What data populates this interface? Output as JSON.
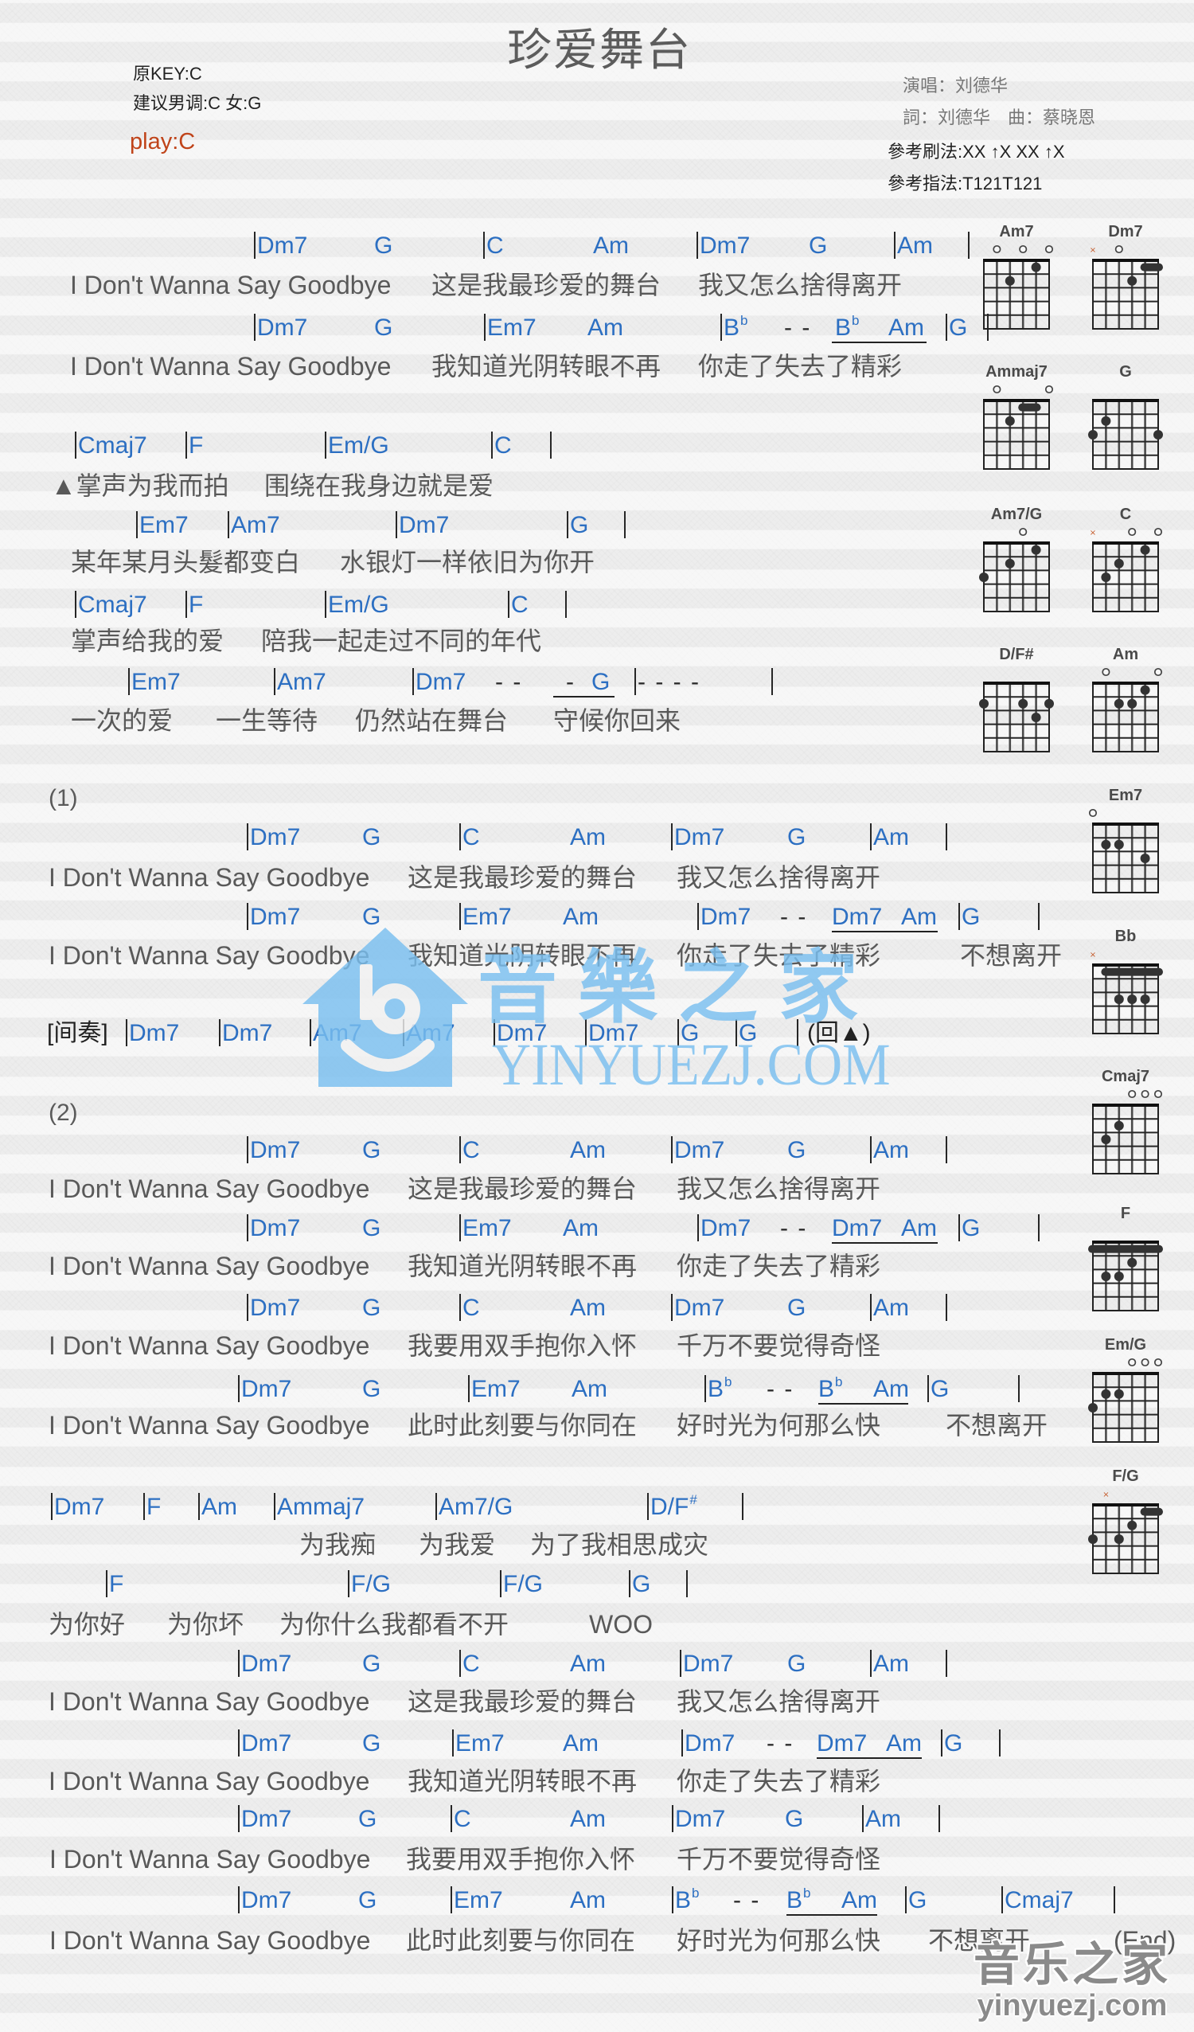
{
  "title": "珍爱舞台",
  "header": {
    "original_key": "原KEY:C",
    "suggested_key": "建议男调:C 女:G",
    "play_key": "play:C",
    "singer": "演唱：刘德华",
    "credits": "詞：刘德华　曲：蔡晓恩",
    "strum_pattern": "參考刷法:XX ↑X XX ↑X",
    "finger_pattern": "參考指法:T121T121"
  },
  "colors": {
    "chord": "#2c6fc2",
    "lyrics": "#595959",
    "play_key": "#c0441a",
    "watermark": "#79bff0"
  },
  "rows": [
    {
      "type": "chords",
      "items": [
        {
          "bar": true,
          "chord": "Dm7"
        },
        {
          "chord": "G"
        },
        {
          "bar": true,
          "chord": "C"
        },
        {
          "chord": "Am"
        },
        {
          "bar": true,
          "chord": "Dm7"
        },
        {
          "chord": "G"
        },
        {
          "bar": true,
          "chord": "Am"
        },
        {
          "bar": true
        }
      ]
    },
    {
      "type": "lyrics",
      "items": [
        "I Don't Wanna Say Goodbye",
        "这是我最珍爱的舞台",
        "我又怎么捨得离开"
      ]
    },
    {
      "type": "chords",
      "items": [
        {
          "bar": true,
          "chord": "Dm7"
        },
        {
          "chord": "G"
        },
        {
          "bar": true,
          "chord": "Em7"
        },
        {
          "chord": "Am"
        },
        {
          "bar": true,
          "chord": "B",
          "sup": "b"
        },
        {
          "text": "- -"
        },
        {
          "chord": "B",
          "sup": "b",
          "tied": true
        },
        {
          "chord": "Am",
          "tied": true
        },
        {
          "bar": true,
          "chord": "G"
        },
        {
          "bar": true
        }
      ]
    },
    {
      "type": "lyrics",
      "items": [
        "I Don't Wanna Say Goodbye",
        "我知道光阴转眼不再",
        "你走了失去了精彩"
      ]
    },
    {
      "type": "chords",
      "items": [
        {
          "bar": true,
          "chord": "Cmaj7"
        },
        {
          "bar": true,
          "chord": "F"
        },
        {
          "bar": true,
          "chord": "Em/G"
        },
        {
          "bar": true,
          "chord": "C"
        },
        {
          "bar": true
        }
      ]
    },
    {
      "type": "lyrics",
      "items": [
        "▲掌声为我而拍",
        "围绕在我身边就是爱"
      ]
    },
    {
      "type": "chords",
      "items": [
        {
          "bar": true,
          "chord": "Em7"
        },
        {
          "bar": true,
          "chord": "Am7"
        },
        {
          "bar": true,
          "chord": "Dm7"
        },
        {
          "bar": true,
          "chord": "G"
        },
        {
          "bar": true
        }
      ]
    },
    {
      "type": "lyrics",
      "items": [
        "某年某月头髮都变白",
        "水银灯一样依旧为你开"
      ]
    },
    {
      "type": "chords",
      "items": [
        {
          "bar": true,
          "chord": "Cmaj7"
        },
        {
          "bar": true,
          "chord": "F"
        },
        {
          "bar": true,
          "chord": "Em/G"
        },
        {
          "bar": true,
          "chord": "C"
        },
        {
          "bar": true
        }
      ]
    },
    {
      "type": "lyrics",
      "items": [
        "掌声给我的爱",
        "陪我一起走过不同的年代"
      ]
    },
    {
      "type": "chords",
      "items": [
        {
          "bar": true,
          "chord": "Em7"
        },
        {
          "bar": true,
          "chord": "Am7"
        },
        {
          "bar": true,
          "chord": "Dm7"
        },
        {
          "text": "- -"
        },
        {
          "text": "-",
          "tied": true
        },
        {
          "chord": "G",
          "tied": true
        },
        {
          "bar": true,
          "text": "- - - -"
        },
        {
          "bar": true
        }
      ]
    },
    {
      "type": "lyrics",
      "items": [
        "一次的爱",
        "一生等待",
        "仍然站在舞台",
        "守候你回来"
      ]
    },
    {
      "type": "label",
      "items": [
        "(1)"
      ]
    },
    {
      "type": "chords",
      "items": [
        {
          "bar": true,
          "chord": "Dm7"
        },
        {
          "chord": "G"
        },
        {
          "bar": true,
          "chord": "C"
        },
        {
          "chord": "Am"
        },
        {
          "bar": true,
          "chord": "Dm7"
        },
        {
          "chord": "G"
        },
        {
          "bar": true,
          "chord": "Am"
        },
        {
          "bar": true
        }
      ]
    },
    {
      "type": "lyrics",
      "items": [
        "I Don't Wanna Say Goodbye",
        "这是我最珍爱的舞台",
        "我又怎么捨得离开"
      ]
    },
    {
      "type": "chords",
      "items": [
        {
          "bar": true,
          "chord": "Dm7"
        },
        {
          "chord": "G"
        },
        {
          "bar": true,
          "chord": "Em7"
        },
        {
          "chord": "Am"
        },
        {
          "bar": true,
          "chord": "Dm7"
        },
        {
          "text": "- -"
        },
        {
          "chord": "Dm7",
          "tied": true
        },
        {
          "chord": "Am",
          "tied": true
        },
        {
          "bar": true,
          "chord": "G"
        },
        {
          "bar": true
        }
      ]
    },
    {
      "type": "lyrics",
      "items": [
        "I Don't Wanna Say Goodbye",
        "我知道光阴转眼不再",
        "你走了失去了精彩",
        "不想离开"
      ]
    },
    {
      "type": "chords",
      "items": [
        {
          "label": "[间奏]"
        },
        {
          "bar": true,
          "chord": "Dm7"
        },
        {
          "bar": true,
          "chord": "Dm7"
        },
        {
          "bar": true,
          "chord": "Am7"
        },
        {
          "bar": true,
          "chord": "Am7"
        },
        {
          "bar": true,
          "chord": "Dm7"
        },
        {
          "bar": true,
          "chord": "Dm7"
        },
        {
          "bar": true,
          "chord": "G"
        },
        {
          "bar": true,
          "chord": "G"
        },
        {
          "bar": true
        },
        {
          "label": "(回▲)"
        }
      ]
    },
    {
      "type": "label",
      "items": [
        "(2)"
      ]
    },
    {
      "type": "chords",
      "items": [
        {
          "bar": true,
          "chord": "Dm7"
        },
        {
          "chord": "G"
        },
        {
          "bar": true,
          "chord": "C"
        },
        {
          "chord": "Am"
        },
        {
          "bar": true,
          "chord": "Dm7"
        },
        {
          "chord": "G"
        },
        {
          "bar": true,
          "chord": "Am"
        },
        {
          "bar": true
        }
      ]
    },
    {
      "type": "lyrics",
      "items": [
        "I Don't Wanna Say Goodbye",
        "这是我最珍爱的舞台",
        "我又怎么捨得离开"
      ]
    },
    {
      "type": "chords",
      "items": [
        {
          "bar": true,
          "chord": "Dm7"
        },
        {
          "chord": "G"
        },
        {
          "bar": true,
          "chord": "Em7"
        },
        {
          "chord": "Am"
        },
        {
          "bar": true,
          "chord": "Dm7"
        },
        {
          "text": "- -"
        },
        {
          "chord": "Dm7",
          "tied": true
        },
        {
          "chord": "Am",
          "tied": true
        },
        {
          "bar": true,
          "chord": "G"
        },
        {
          "bar": true
        }
      ]
    },
    {
      "type": "lyrics",
      "items": [
        "I Don't Wanna Say Goodbye",
        "我知道光阴转眼不再",
        "你走了失去了精彩"
      ]
    },
    {
      "type": "chords",
      "items": [
        {
          "bar": true,
          "chord": "Dm7"
        },
        {
          "chord": "G"
        },
        {
          "bar": true,
          "chord": "C"
        },
        {
          "chord": "Am"
        },
        {
          "bar": true,
          "chord": "Dm7"
        },
        {
          "chord": "G"
        },
        {
          "bar": true,
          "chord": "Am"
        },
        {
          "bar": true
        }
      ]
    },
    {
      "type": "lyrics",
      "items": [
        "I Don't Wanna Say Goodbye",
        "我要用双手抱你入怀",
        "千万不要觉得奇怪"
      ]
    },
    {
      "type": "chords",
      "items": [
        {
          "bar": true,
          "chord": "Dm7"
        },
        {
          "chord": "G"
        },
        {
          "bar": true,
          "chord": "Em7"
        },
        {
          "chord": "Am"
        },
        {
          "bar": true,
          "chord": "B",
          "sup": "b"
        },
        {
          "text": "- -"
        },
        {
          "chord": "B",
          "sup": "b",
          "tied": true
        },
        {
          "chord": "Am",
          "tied": true
        },
        {
          "bar": true,
          "chord": "G"
        },
        {
          "bar": true
        }
      ]
    },
    {
      "type": "lyrics",
      "items": [
        "I Don't Wanna Say Goodbye",
        "此时此刻要与你同在",
        "好时光为何那么快",
        "不想离开"
      ]
    },
    {
      "type": "chords",
      "items": [
        {
          "bar": true,
          "chord": "Dm7"
        },
        {
          "bar": true,
          "chord": "F"
        },
        {
          "bar": true,
          "chord": "Am"
        },
        {
          "bar": true,
          "chord": "Ammaj7"
        },
        {
          "bar": true,
          "chord": "Am7/G"
        },
        {
          "bar": true,
          "chord": "D/F",
          "sup": "#"
        },
        {
          "bar": true
        }
      ]
    },
    {
      "type": "lyrics",
      "items": [
        "为我痴",
        "为我爱",
        "为了我相思成灾"
      ]
    },
    {
      "type": "chords",
      "items": [
        {
          "bar": true,
          "chord": "F"
        },
        {
          "bar": true,
          "chord": "F/G"
        },
        {
          "bar": true,
          "chord": "F/G"
        },
        {
          "bar": true,
          "chord": "G"
        },
        {
          "bar": true
        }
      ]
    },
    {
      "type": "lyrics",
      "items": [
        "为你好",
        "为你坏",
        "为你什么我都看不开",
        "WOO"
      ]
    },
    {
      "type": "chords",
      "items": [
        {
          "bar": true,
          "chord": "Dm7"
        },
        {
          "chord": "G"
        },
        {
          "bar": true,
          "chord": "C"
        },
        {
          "chord": "Am"
        },
        {
          "bar": true,
          "chord": "Dm7"
        },
        {
          "chord": "G"
        },
        {
          "bar": true,
          "chord": "Am"
        },
        {
          "bar": true
        }
      ]
    },
    {
      "type": "lyrics",
      "items": [
        "I Don't Wanna Say Goodbye",
        "这是我最珍爱的舞台",
        "我又怎么捨得离开"
      ]
    },
    {
      "type": "chords",
      "items": [
        {
          "bar": true,
          "chord": "Dm7"
        },
        {
          "chord": "G"
        },
        {
          "bar": true,
          "chord": "Em7"
        },
        {
          "chord": "Am"
        },
        {
          "bar": true,
          "chord": "Dm7"
        },
        {
          "text": "- -"
        },
        {
          "chord": "Dm7",
          "tied": true
        },
        {
          "chord": "Am",
          "tied": true
        },
        {
          "bar": true,
          "chord": "G"
        },
        {
          "bar": true
        }
      ]
    },
    {
      "type": "lyrics",
      "items": [
        "I Don't Wanna Say Goodbye",
        "我知道光阴转眼不再",
        "你走了失去了精彩"
      ]
    },
    {
      "type": "chords",
      "items": [
        {
          "bar": true,
          "chord": "Dm7"
        },
        {
          "chord": "G"
        },
        {
          "bar": true,
          "chord": "C"
        },
        {
          "chord": "Am"
        },
        {
          "bar": true,
          "chord": "Dm7"
        },
        {
          "chord": "G"
        },
        {
          "bar": true,
          "chord": "Am"
        },
        {
          "bar": true
        }
      ]
    },
    {
      "type": "lyrics",
      "items": [
        "I Don't Wanna Say Goodbye",
        "我要用双手抱你入怀",
        "千万不要觉得奇怪"
      ]
    },
    {
      "type": "chords",
      "items": [
        {
          "bar": true,
          "chord": "Dm7"
        },
        {
          "chord": "G"
        },
        {
          "bar": true,
          "chord": "Em7"
        },
        {
          "chord": "Am"
        },
        {
          "bar": true,
          "chord": "B",
          "sup": "b"
        },
        {
          "text": "- -"
        },
        {
          "chord": "B",
          "sup": "b",
          "tied": true
        },
        {
          "chord": "Am",
          "tied": true
        },
        {
          "bar": true,
          "chord": "G"
        },
        {
          "bar": true,
          "chord": "Cmaj7"
        },
        {
          "bar": true
        }
      ]
    },
    {
      "type": "lyrics",
      "items": [
        "I Don't Wanna Say Goodbye",
        "此时此刻要与你同在",
        "好时光为何那么快",
        "不想离开",
        "(End)"
      ]
    }
  ],
  "chord_diagrams": [
    {
      "name": "Am7",
      "strings": [
        "",
        "o",
        "",
        "o",
        "",
        "o"
      ],
      "dots": [
        {
          "string": 4,
          "fret": 2
        },
        {
          "string": 2,
          "fret": 1
        }
      ],
      "barres": []
    },
    {
      "name": "Dm7",
      "strings": [
        "x",
        "",
        "o",
        "",
        "",
        ""
      ],
      "dots": [
        {
          "string": 3,
          "fret": 2
        }
      ],
      "barres": [
        {
          "fret": 1,
          "from": 2,
          "to": 1
        }
      ]
    },
    {
      "name": "Ammaj7",
      "strings": [
        "",
        "o",
        "",
        "",
        "",
        "o"
      ],
      "dots": [
        {
          "string": 4,
          "fret": 2
        }
      ],
      "barres": [
        {
          "fret": 1,
          "from": 3,
          "to": 2
        }
      ]
    },
    {
      "name": "G",
      "strings": [
        "",
        "",
        "",
        "",
        "",
        ""
      ],
      "dots": [
        {
          "string": 6,
          "fret": 3
        },
        {
          "string": 5,
          "fret": 2
        },
        {
          "string": 1,
          "fret": 3
        }
      ],
      "barres": []
    },
    {
      "name": "Am7/G",
      "strings": [
        "",
        "",
        "",
        "o",
        "",
        ""
      ],
      "dots": [
        {
          "string": 6,
          "fret": 3
        },
        {
          "string": 4,
          "fret": 2
        },
        {
          "string": 2,
          "fret": 1
        }
      ],
      "barres": []
    },
    {
      "name": "C",
      "strings": [
        "x",
        "",
        "",
        "o",
        "",
        "o"
      ],
      "dots": [
        {
          "string": 5,
          "fret": 3
        },
        {
          "string": 4,
          "fret": 2
        },
        {
          "string": 2,
          "fret": 1
        }
      ],
      "barres": []
    },
    {
      "name": "D/F#",
      "strings": [
        "",
        "",
        "",
        "",
        "",
        ""
      ],
      "dots": [
        {
          "string": 6,
          "fret": 2
        },
        {
          "string": 3,
          "fret": 2
        },
        {
          "string": 1,
          "fret": 2
        },
        {
          "string": 2,
          "fret": 3
        }
      ],
      "barres": []
    },
    {
      "name": "Am",
      "strings": [
        "",
        "o",
        "",
        "",
        "",
        "o"
      ],
      "dots": [
        {
          "string": 4,
          "fret": 2
        },
        {
          "string": 3,
          "fret": 2
        },
        {
          "string": 2,
          "fret": 1
        }
      ],
      "barres": []
    },
    {
      "name": "Em7",
      "strings": [
        "o",
        "",
        "",
        "",
        "",
        ""
      ],
      "dots": [
        {
          "string": 5,
          "fret": 2
        },
        {
          "string": 4,
          "fret": 2
        },
        {
          "string": 2,
          "fret": 3
        }
      ],
      "barres": []
    },
    {
      "name": "Bb",
      "strings": [
        "x",
        "",
        "",
        "",
        "",
        ""
      ],
      "dots": [
        {
          "string": 4,
          "fret": 3
        },
        {
          "string": 3,
          "fret": 3
        },
        {
          "string": 2,
          "fret": 3
        }
      ],
      "barres": [
        {
          "fret": 1,
          "from": 5,
          "to": 1
        }
      ]
    },
    {
      "name": "Cmaj7",
      "strings": [
        "",
        "",
        "",
        "o",
        "o",
        "o"
      ],
      "dots": [
        {
          "string": 4,
          "fret": 2
        },
        {
          "string": 5,
          "fret": 3
        }
      ],
      "barres": []
    },
    {
      "name": "F",
      "strings": [
        "",
        "",
        "",
        "",
        "",
        ""
      ],
      "dots": [
        {
          "string": 3,
          "fret": 2
        },
        {
          "string": 5,
          "fret": 3
        },
        {
          "string": 4,
          "fret": 3
        }
      ],
      "barres": [
        {
          "fret": 1,
          "from": 6,
          "to": 1
        }
      ]
    },
    {
      "name": "Em/G",
      "strings": [
        "",
        "",
        "",
        "o",
        "o",
        "o"
      ],
      "dots": [
        {
          "string": 5,
          "fret": 2
        },
        {
          "string": 4,
          "fret": 2
        },
        {
          "string": 6,
          "fret": 3
        }
      ],
      "barres": []
    },
    {
      "name": "F/G",
      "strings": [
        "",
        "x",
        "",
        "",
        "",
        ""
      ],
      "dots": [
        {
          "string": 3,
          "fret": 2
        },
        {
          "string": 6,
          "fret": 3
        },
        {
          "string": 4,
          "fret": 3
        }
      ],
      "barres": [
        {
          "fret": 1,
          "from": 2,
          "to": 1
        }
      ]
    }
  ],
  "watermark": {
    "center_cn": "音樂之家",
    "center_en": "YINYUEZJ.COM",
    "corner_cn": "音乐之家",
    "corner_en": "yinyuezj.com"
  }
}
